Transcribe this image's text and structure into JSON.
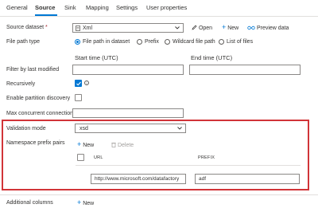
{
  "tabs": [
    {
      "label": "General",
      "active": false
    },
    {
      "label": "Source",
      "active": true
    },
    {
      "label": "Sink",
      "active": false
    },
    {
      "label": "Mapping",
      "active": false
    },
    {
      "label": "Settings",
      "active": false
    },
    {
      "label": "User properties",
      "active": false
    }
  ],
  "source_dataset": {
    "label": "Source dataset",
    "required_mark": "*",
    "value": "Xml",
    "open_label": "Open",
    "new_label": "New",
    "preview_label": "Preview data"
  },
  "file_path_type": {
    "label": "File path type",
    "options": [
      "File path in dataset",
      "Prefix",
      "Wildcard file path",
      "List of files"
    ],
    "selected": "File path in dataset"
  },
  "filter": {
    "label": "Filter by last modified",
    "start_label": "Start time (UTC)",
    "end_label": "End time (UTC)",
    "start_value": "",
    "end_value": ""
  },
  "recursively": {
    "label": "Recursively",
    "checked": true
  },
  "partition_discovery": {
    "label": "Enable partition discovery",
    "checked": false
  },
  "max_connections": {
    "label": "Max concurrent connections",
    "value": ""
  },
  "validation_mode": {
    "label": "Validation mode",
    "value": "xsd"
  },
  "namespace": {
    "label": "Namespace prefix pairs",
    "new_label": "New",
    "delete_label": "Delete",
    "col_url": "URL",
    "col_prefix": "PREFIX",
    "rows": [
      {
        "url": "http://www.microsoft.com/datafactory",
        "prefix": "adf"
      }
    ]
  },
  "additional_columns": {
    "label": "Additional columns",
    "new_label": "New"
  },
  "colors": {
    "accent": "#0078d4",
    "highlight_border": "#d13438",
    "required": "#a4262c"
  }
}
